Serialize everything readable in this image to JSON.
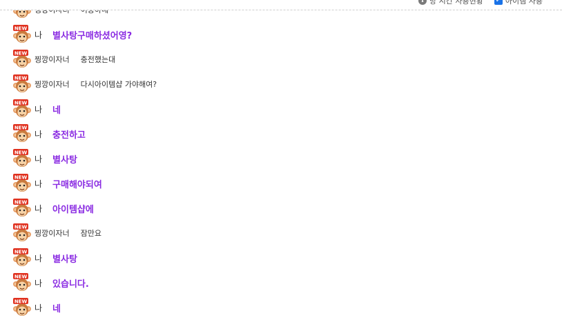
{
  "topbar": {
    "setting_text_1": "방 시간 사용현황",
    "setting_text_2": "아이템 사용"
  },
  "messages": [
    {
      "sender": "찡깡이자너",
      "text": "이용하네",
      "is_me": false
    },
    {
      "sender": "나",
      "text": "별사탕구매하셨어영?",
      "is_me": true
    },
    {
      "sender": "찡깡이자너",
      "text": "충전했는대",
      "is_me": false
    },
    {
      "sender": "찡깡이자너",
      "text": "다시아이템샵 가야해여?",
      "is_me": false
    },
    {
      "sender": "나",
      "text": "네",
      "is_me": true
    },
    {
      "sender": "나",
      "text": "충전하고",
      "is_me": true
    },
    {
      "sender": "나",
      "text": "별사탕",
      "is_me": true
    },
    {
      "sender": "나",
      "text": "구매해야되여",
      "is_me": true
    },
    {
      "sender": "나",
      "text": "아이템샵에",
      "is_me": true
    },
    {
      "sender": "찡깡이자너",
      "text": "잠만요",
      "is_me": false
    },
    {
      "sender": "나",
      "text": "별사탕",
      "is_me": true
    },
    {
      "sender": "나",
      "text": "있습니다.",
      "is_me": true
    },
    {
      "sender": "나",
      "text": "네",
      "is_me": true
    }
  ],
  "icons": {
    "avatar": "new-badge-monkey-avatar-icon",
    "info": "info-icon",
    "checkbox": "checkbox-checked-icon"
  },
  "colors": {
    "my_message": "#8a2be2",
    "other_message": "#333333",
    "new_badge": "#e0301e"
  }
}
